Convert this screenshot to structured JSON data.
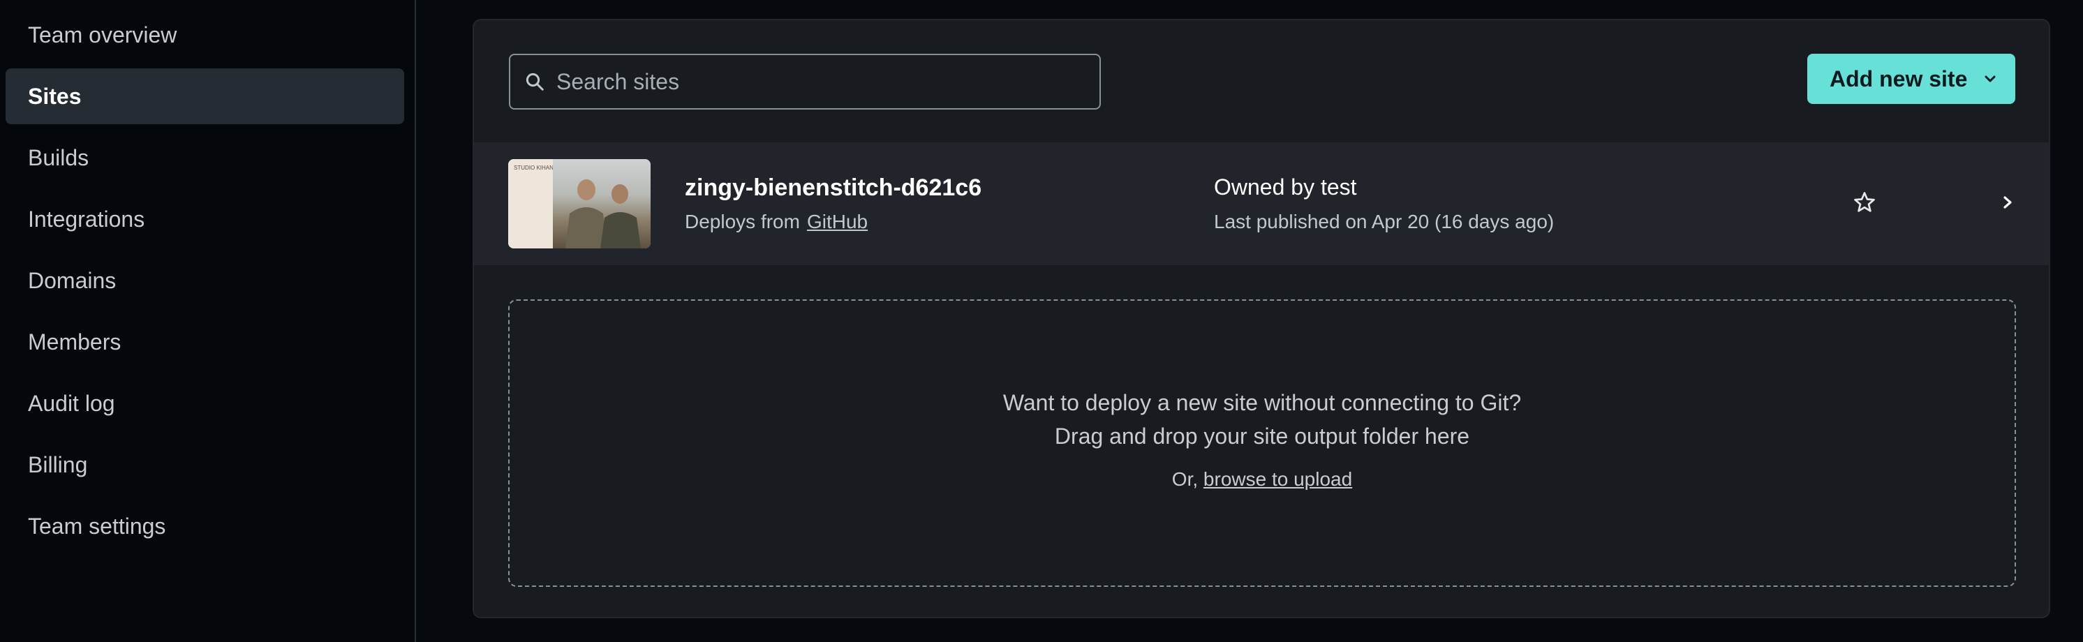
{
  "sidebar": {
    "items": [
      {
        "label": "Team overview",
        "active": false
      },
      {
        "label": "Sites",
        "active": true
      },
      {
        "label": "Builds",
        "active": false
      },
      {
        "label": "Integrations",
        "active": false
      },
      {
        "label": "Domains",
        "active": false
      },
      {
        "label": "Members",
        "active": false
      },
      {
        "label": "Audit log",
        "active": false
      },
      {
        "label": "Billing",
        "active": false
      },
      {
        "label": "Team settings",
        "active": false
      }
    ]
  },
  "search": {
    "placeholder": "Search sites",
    "value": "",
    "icon": "search-icon"
  },
  "toolbar": {
    "add_label": "Add new site",
    "add_icon": "chevron-down-icon"
  },
  "site": {
    "name": "zingy-bienenstitch-d621c6",
    "deploys_prefix": "Deploys from",
    "deploys_source": "GitHub",
    "owned_by": "Owned by test",
    "published": "Last published on Apr 20 (16 days ago)",
    "thumbnail_text": "STUDIO KIHANA",
    "favorite_icon": "star-icon",
    "open_icon": "chevron-right-icon"
  },
  "dropzone": {
    "line1": "Want to deploy a new site without connecting to Git?",
    "line2": "Drag and drop your site output folder here",
    "prefix": "Or,",
    "link": "browse to upload"
  },
  "colors": {
    "accent": "#67e0d8",
    "background": "#06090e",
    "panel": "#181b20",
    "row": "#21252b"
  }
}
